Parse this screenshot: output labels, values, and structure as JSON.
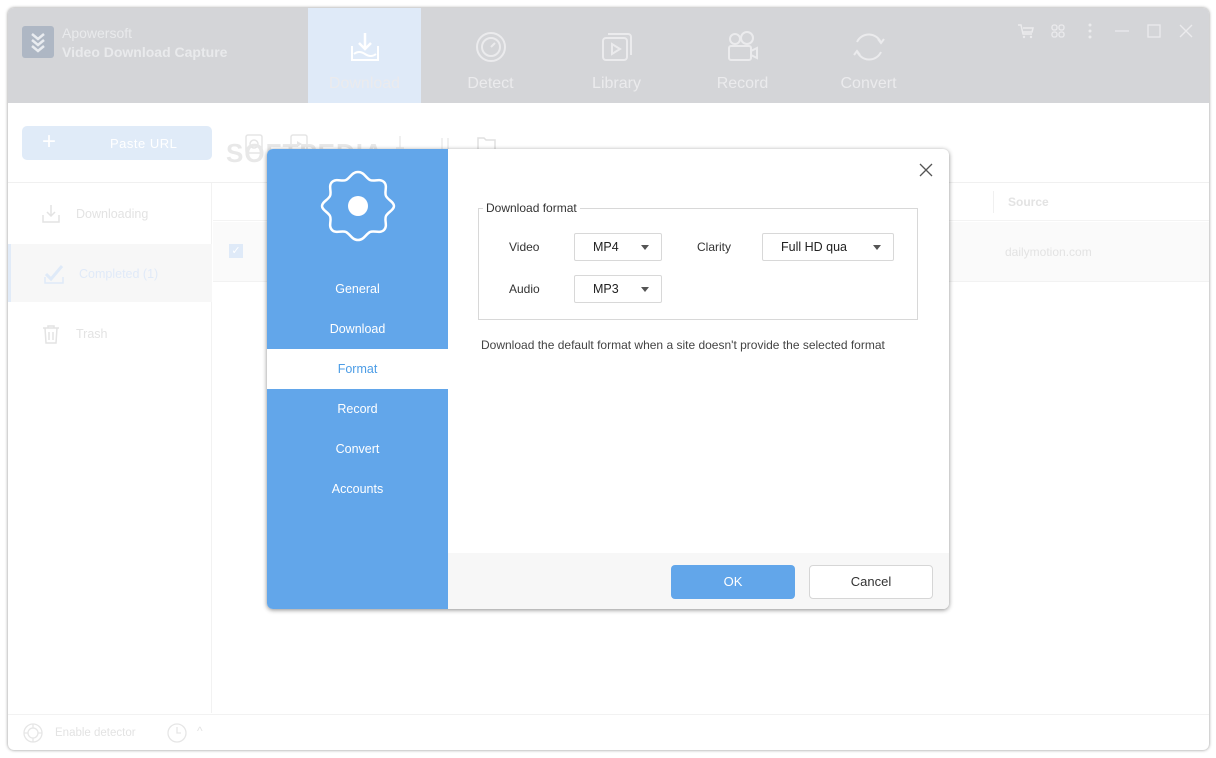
{
  "app": {
    "vendor": "Apowersoft",
    "title": "Video Download Capture"
  },
  "nav": [
    {
      "label": "Download",
      "icon": "download-icon",
      "active": true
    },
    {
      "label": "Detect",
      "icon": "detect-icon",
      "active": false
    },
    {
      "label": "Library",
      "icon": "library-icon",
      "active": false
    },
    {
      "label": "Record",
      "icon": "record-icon",
      "active": false
    },
    {
      "label": "Convert",
      "icon": "convert-icon",
      "active": false
    }
  ],
  "window_controls": [
    "cart-icon",
    "apps-icon",
    "more-icon",
    "minimize-icon",
    "maximize-icon",
    "close-icon"
  ],
  "toolbar": {
    "paste_url": "Paste URL",
    "watermark": "SOFTPEDIA"
  },
  "sidebar": {
    "items": [
      {
        "label": "Downloading",
        "icon": "download-icon"
      },
      {
        "label": "Completed (1)",
        "icon": "check-icon",
        "active": true
      },
      {
        "label": "Trash",
        "icon": "trash-icon"
      }
    ]
  },
  "table": {
    "columns": {
      "source": "Source"
    },
    "rows": [
      {
        "checked": true,
        "source": "dailymotion.com"
      }
    ]
  },
  "statusbar": {
    "enable_detector": "Enable detector"
  },
  "dialog": {
    "nav": [
      {
        "label": "General"
      },
      {
        "label": "Download"
      },
      {
        "label": "Format",
        "active": true
      },
      {
        "label": "Record"
      },
      {
        "label": "Convert"
      },
      {
        "label": "Accounts"
      }
    ],
    "group_title": "Download format",
    "video_label": "Video",
    "video_value": "MP4",
    "clarity_label": "Clarity",
    "clarity_value": "Full HD qua",
    "audio_label": "Audio",
    "audio_value": "MP3",
    "hint": "Download the default format when a site doesn't provide the selected format",
    "ok": "OK",
    "cancel": "Cancel"
  },
  "colors": {
    "accent": "#62a6ea",
    "header_bg": "#d4d5d8"
  }
}
